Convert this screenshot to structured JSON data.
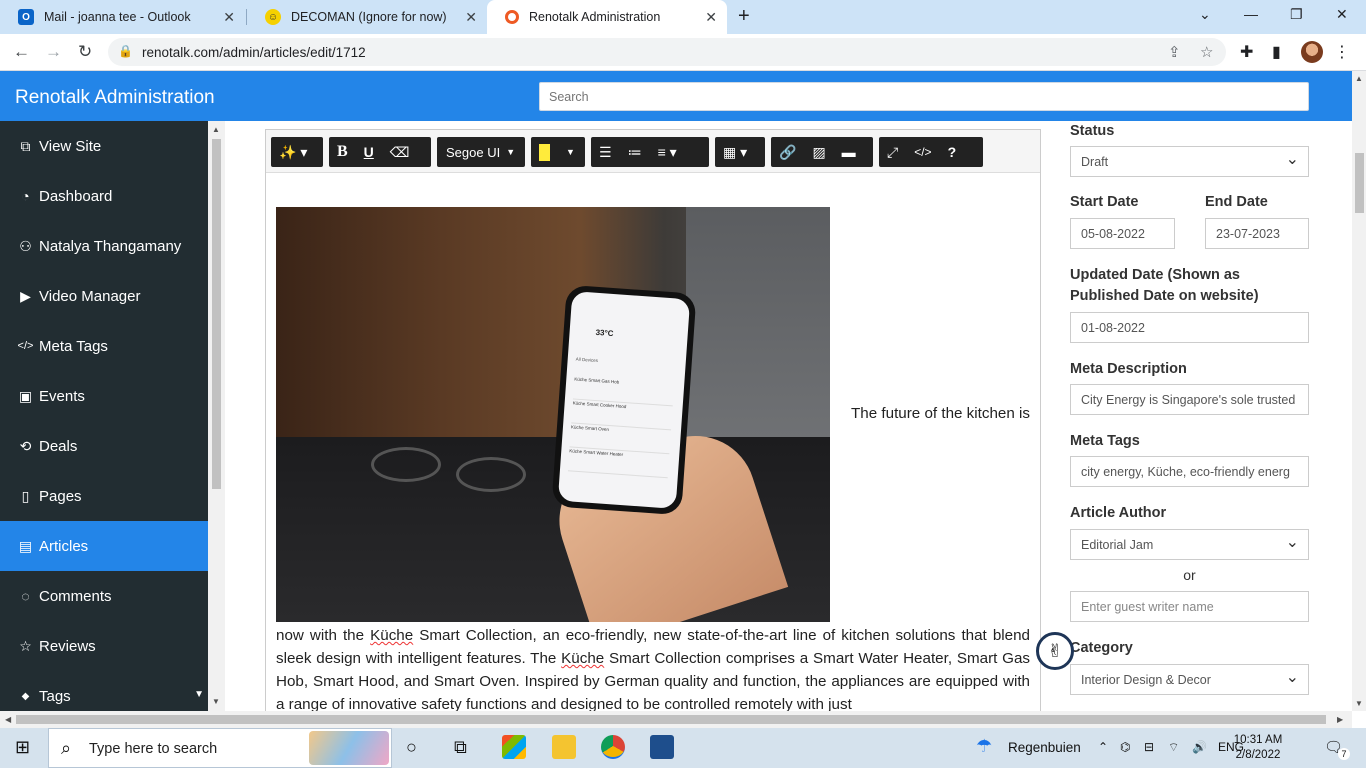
{
  "browser": {
    "tabs": [
      {
        "title": "Mail - joanna tee - Outlook",
        "icon": "outlook-icon"
      },
      {
        "title": "DECOMAN (Ignore for now)",
        "icon": "decoman-icon"
      },
      {
        "title": "Renotalk Administration",
        "icon": "renotalk-icon"
      }
    ],
    "url": "renotalk.com/admin/articles/edit/1712"
  },
  "header": {
    "brand": "Renotalk Administration",
    "search_placeholder": "Search"
  },
  "sidebar": {
    "items": [
      {
        "label": "View Site",
        "icon": "external-link-icon",
        "glyph": "⧉"
      },
      {
        "label": "Dashboard",
        "icon": "dashboard-icon",
        "glyph": "◔"
      },
      {
        "label": "Natalya Thangamany",
        "icon": "user-icon",
        "glyph": "⚇"
      },
      {
        "label": "Video Manager",
        "icon": "video-icon",
        "glyph": "▶"
      },
      {
        "label": "Meta Tags",
        "icon": "code-icon",
        "glyph": "</>"
      },
      {
        "label": "Events",
        "icon": "calendar-icon",
        "glyph": "▣"
      },
      {
        "label": "Deals",
        "icon": "deals-icon",
        "glyph": "⟲"
      },
      {
        "label": "Pages",
        "icon": "page-icon",
        "glyph": "▯"
      },
      {
        "label": "Articles",
        "icon": "articles-icon",
        "glyph": "▤"
      },
      {
        "label": "Comments",
        "icon": "comment-icon",
        "glyph": "◌"
      },
      {
        "label": "Reviews",
        "icon": "star-icon",
        "glyph": "☆"
      },
      {
        "label": "Tags",
        "icon": "tag-icon",
        "glyph": "◆"
      }
    ]
  },
  "editor": {
    "font_name": "Segoe UI",
    "body_start": "The future of the kitchen is",
    "body_p1": "now with the ",
    "kuche1": "Küche",
    "body_p2": " Smart Collection, an eco-friendly, new state-of-the-art line of kitchen solutions that blend sleek design with intelligent features. The ",
    "kuche2": "Küche",
    "body_p3": " Smart Collection comprises a Smart Water Heater, Smart Gas Hob, Smart Hood, and Smart Oven. Inspired by German quality and function, the appliances are equipped with a range of innovative safety functions and designed to be controlled remotely with just",
    "phone_temp": "33°C",
    "phone_section": "All Devices",
    "phone_devices": [
      "Küche Smart Gas Hob",
      "Küche Smart Cooker Hood",
      "Küche Smart Oven",
      "Küche Smart Water Heater"
    ]
  },
  "form": {
    "status_label": "Status",
    "status_value": "Draft",
    "start_label": "Start Date",
    "start_value": "05-08-2022",
    "end_label": "End Date",
    "end_value": "23-07-2023",
    "updated_label": "Updated Date (Shown as Published Date on website)",
    "updated_value": "01-08-2022",
    "meta_desc_label": "Meta Description",
    "meta_desc_value": "City Energy is Singapore's sole trusted",
    "meta_tags_label": "Meta Tags",
    "meta_tags_value": "city energy, Küche, eco-friendly energ",
    "author_label": "Article Author",
    "author_value": "Editorial Jam",
    "or_text": "or",
    "guest_placeholder": "Enter guest writer name",
    "category_label": "Category",
    "category_value": "Interior Design & Decor"
  },
  "taskbar": {
    "search_text": "Type here to search",
    "weather": "Regenbuien",
    "lang": "ENG",
    "time": "10:31 AM",
    "date": "2/8/2022",
    "notif_count": "7"
  },
  "colors": {
    "accent": "#2385e8",
    "sidebar_bg": "#222d32"
  }
}
